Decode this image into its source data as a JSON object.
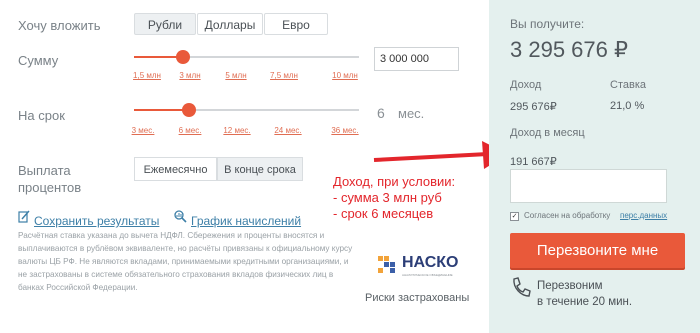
{
  "form": {
    "invest_label": "Хочу вложить",
    "currency_tabs": [
      "Рубли",
      "Доллары",
      "Евро"
    ],
    "amount_label": "Сумму",
    "amount_ticks": [
      "1,5 млн",
      "3 млн",
      "5 млн",
      "7,5 млн",
      "10 млн"
    ],
    "amount_value": "3 000 000",
    "term_label": "На срок",
    "term_ticks": [
      "3 мес.",
      "6 мес.",
      "12 мес.",
      "24 мес.",
      "36 мес."
    ],
    "term_value": "6",
    "term_unit": "мес.",
    "payout_label_line1": "Выплата",
    "payout_label_line2": "процентов",
    "payout_options": [
      "Ежемесячно",
      "В конце срока"
    ],
    "save_link": "Сохранить результаты",
    "chart_link": "График начислений",
    "disclaimer": "Расчётная ставка указана до вычета НДФЛ. Сбережения и проценты вносятся и выплачиваются в рублёвом эквиваленте, но расчёты привязаны к официальному курсу валюты ЦБ РФ. Не являются вкладами, принимаемыми кредитными организациями, и не застрахованы в системе обязательного страхования вкладов физических лиц в банках Российской Федерации.",
    "logo_text": "НАСКО",
    "logo_subtext": "АНАЛИТИЧЕСКОЕ ОБЪЕДИНЕНИЕ",
    "insured_text": "Риски застрахованы"
  },
  "annotation": {
    "line1": "Доход, при условии:",
    "line2": "- сумма 3 млн руб",
    "line3": "- срок 6 месяцев",
    "color": "#e3262c"
  },
  "result": {
    "you_get_label": "Вы получите:",
    "you_get_value": "3 295 676 ₽",
    "income_label": "Доход",
    "income_value": "295 676₽",
    "rate_label": "Ставка",
    "rate_value": "21,0 %",
    "monthly_label": "Доход в месяц",
    "monthly_value": "191 667₽",
    "consent_text": "Согласен на обработку",
    "consent_link": "перс.данных",
    "callback_button": "Перезвоните мне",
    "callback_note_line1": "Перезвоним",
    "callback_note_line2": "в течение 20 мин."
  },
  "colors": {
    "accent": "#e9593a",
    "panel_bg": "#e4f0ee",
    "link": "#3d7fa7"
  }
}
